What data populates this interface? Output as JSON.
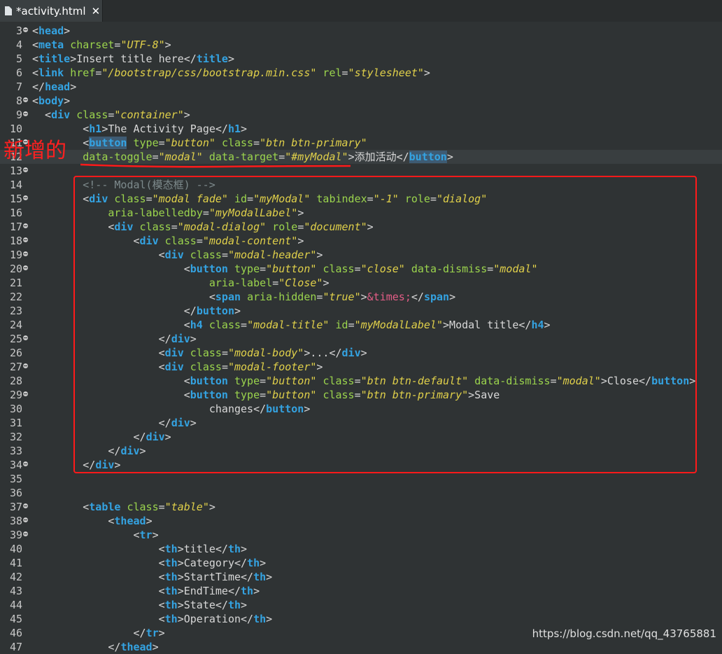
{
  "tab": {
    "title": "*activity.html",
    "close": "✕"
  },
  "annotation": {
    "text": "新增的"
  },
  "watermark": "https://blog.csdn.net/qq_43765881",
  "colors": {
    "tag": "#34a3e2",
    "attr": "#9bd44d",
    "value": "#e0d04a",
    "comment": "#7d8a8c",
    "entity": "#e35d86",
    "annotation": "#ff2020"
  },
  "lines": [
    {
      "n": "3",
      "fold": true,
      "tokens": [
        [
          "p",
          "<"
        ],
        [
          "t",
          "head"
        ],
        [
          "p",
          ">"
        ]
      ]
    },
    {
      "n": "4",
      "fold": false,
      "tokens": [
        [
          "p",
          "<"
        ],
        [
          "t",
          "meta"
        ],
        [
          "p",
          " "
        ],
        [
          "a",
          "charset"
        ],
        [
          "p",
          "="
        ],
        [
          "v",
          "\"UTF-8\""
        ],
        [
          "p",
          ">"
        ]
      ]
    },
    {
      "n": "5",
      "fold": false,
      "tokens": [
        [
          "p",
          "<"
        ],
        [
          "t",
          "title"
        ],
        [
          "p",
          ">Insert title here</"
        ],
        [
          "t",
          "title"
        ],
        [
          "p",
          ">"
        ]
      ]
    },
    {
      "n": "6",
      "fold": false,
      "tokens": [
        [
          "p",
          "<"
        ],
        [
          "t",
          "link"
        ],
        [
          "p",
          " "
        ],
        [
          "a",
          "href"
        ],
        [
          "p",
          "="
        ],
        [
          "v",
          "\"/bootstrap/css/bootstrap.min.css\""
        ],
        [
          "p",
          " "
        ],
        [
          "a",
          "rel"
        ],
        [
          "p",
          "="
        ],
        [
          "v",
          "\"stylesheet\""
        ],
        [
          "p",
          ">"
        ]
      ]
    },
    {
      "n": "7",
      "fold": false,
      "tokens": [
        [
          "p",
          "</"
        ],
        [
          "t",
          "head"
        ],
        [
          "p",
          ">"
        ]
      ]
    },
    {
      "n": "8",
      "fold": true,
      "tokens": [
        [
          "p",
          "<"
        ],
        [
          "t",
          "body"
        ],
        [
          "p",
          ">"
        ]
      ]
    },
    {
      "n": "9",
      "fold": true,
      "tokens": [
        [
          "p",
          "  <"
        ],
        [
          "t",
          "div"
        ],
        [
          "p",
          " "
        ],
        [
          "a",
          "class"
        ],
        [
          "p",
          "="
        ],
        [
          "v",
          "\"container\""
        ],
        [
          "p",
          ">"
        ]
      ]
    },
    {
      "n": "10",
      "fold": false,
      "tokens": [
        [
          "p",
          "        <"
        ],
        [
          "t",
          "h1"
        ],
        [
          "p",
          ">The Activity Page</"
        ],
        [
          "t",
          "h1"
        ],
        [
          "p",
          ">"
        ]
      ]
    },
    {
      "n": "11",
      "fold": true,
      "tokens": [
        [
          "p",
          "        <"
        ],
        [
          "ts",
          "button"
        ],
        [
          "p",
          " "
        ],
        [
          "a",
          "type"
        ],
        [
          "p",
          "="
        ],
        [
          "v",
          "\"button\""
        ],
        [
          "p",
          " "
        ],
        [
          "a",
          "class"
        ],
        [
          "p",
          "="
        ],
        [
          "v",
          "\"btn btn-primary\""
        ]
      ]
    },
    {
      "n": "12",
      "fold": false,
      "hl": true,
      "tokens": [
        [
          "p",
          "        "
        ],
        [
          "a",
          "data-toggle"
        ],
        [
          "p",
          "="
        ],
        [
          "v",
          "\"modal\""
        ],
        [
          "p",
          " "
        ],
        [
          "a",
          "data-target"
        ],
        [
          "p",
          "="
        ],
        [
          "v",
          "\"#myModal\""
        ],
        [
          "p",
          ">添加活动</"
        ],
        [
          "ts",
          "button"
        ],
        [
          "p",
          ">"
        ]
      ]
    },
    {
      "n": "13",
      "fold": true,
      "tokens": []
    },
    {
      "n": "14",
      "fold": false,
      "tokens": [
        [
          "p",
          "        "
        ],
        [
          "c",
          "<!-- Modal(模态框) -->"
        ]
      ]
    },
    {
      "n": "15",
      "fold": true,
      "tokens": [
        [
          "p",
          "        <"
        ],
        [
          "t",
          "div"
        ],
        [
          "p",
          " "
        ],
        [
          "a",
          "class"
        ],
        [
          "p",
          "="
        ],
        [
          "v",
          "\"modal fade\""
        ],
        [
          "p",
          " "
        ],
        [
          "a",
          "id"
        ],
        [
          "p",
          "="
        ],
        [
          "v",
          "\"myModal\""
        ],
        [
          "p",
          " "
        ],
        [
          "a",
          "tabindex"
        ],
        [
          "p",
          "="
        ],
        [
          "v",
          "\"-1\""
        ],
        [
          "p",
          " "
        ],
        [
          "a",
          "role"
        ],
        [
          "p",
          "="
        ],
        [
          "v",
          "\"dialog\""
        ]
      ]
    },
    {
      "n": "16",
      "fold": false,
      "tokens": [
        [
          "p",
          "            "
        ],
        [
          "a",
          "aria-labelledby"
        ],
        [
          "p",
          "="
        ],
        [
          "v",
          "\"myModalLabel\""
        ],
        [
          "p",
          ">"
        ]
      ]
    },
    {
      "n": "17",
      "fold": true,
      "tokens": [
        [
          "p",
          "            <"
        ],
        [
          "t",
          "div"
        ],
        [
          "p",
          " "
        ],
        [
          "a",
          "class"
        ],
        [
          "p",
          "="
        ],
        [
          "v",
          "\"modal-dialog\""
        ],
        [
          "p",
          " "
        ],
        [
          "a",
          "role"
        ],
        [
          "p",
          "="
        ],
        [
          "v",
          "\"document\""
        ],
        [
          "p",
          ">"
        ]
      ]
    },
    {
      "n": "18",
      "fold": true,
      "tokens": [
        [
          "p",
          "                <"
        ],
        [
          "t",
          "div"
        ],
        [
          "p",
          " "
        ],
        [
          "a",
          "class"
        ],
        [
          "p",
          "="
        ],
        [
          "v",
          "\"modal-content\""
        ],
        [
          "p",
          ">"
        ]
      ]
    },
    {
      "n": "19",
      "fold": true,
      "tokens": [
        [
          "p",
          "                    <"
        ],
        [
          "t",
          "div"
        ],
        [
          "p",
          " "
        ],
        [
          "a",
          "class"
        ],
        [
          "p",
          "="
        ],
        [
          "v",
          "\"modal-header\""
        ],
        [
          "p",
          ">"
        ]
      ]
    },
    {
      "n": "20",
      "fold": true,
      "tokens": [
        [
          "p",
          "                        <"
        ],
        [
          "t",
          "button"
        ],
        [
          "p",
          " "
        ],
        [
          "a",
          "type"
        ],
        [
          "p",
          "="
        ],
        [
          "v",
          "\"button\""
        ],
        [
          "p",
          " "
        ],
        [
          "a",
          "class"
        ],
        [
          "p",
          "="
        ],
        [
          "v",
          "\"close\""
        ],
        [
          "p",
          " "
        ],
        [
          "a",
          "data-dismiss"
        ],
        [
          "p",
          "="
        ],
        [
          "v",
          "\"modal\""
        ]
      ]
    },
    {
      "n": "21",
      "fold": false,
      "tokens": [
        [
          "p",
          "                            "
        ],
        [
          "a",
          "aria-label"
        ],
        [
          "p",
          "="
        ],
        [
          "v",
          "\"Close\""
        ],
        [
          "p",
          ">"
        ]
      ]
    },
    {
      "n": "22",
      "fold": false,
      "tokens": [
        [
          "p",
          "                            <"
        ],
        [
          "t",
          "span"
        ],
        [
          "p",
          " "
        ],
        [
          "a",
          "aria-hidden"
        ],
        [
          "p",
          "="
        ],
        [
          "v",
          "\"true\""
        ],
        [
          "p",
          ">"
        ],
        [
          "e",
          "&times;"
        ],
        [
          "p",
          "</"
        ],
        [
          "t",
          "span"
        ],
        [
          "p",
          ">"
        ]
      ]
    },
    {
      "n": "23",
      "fold": false,
      "tokens": [
        [
          "p",
          "                        </"
        ],
        [
          "t",
          "button"
        ],
        [
          "p",
          ">"
        ]
      ]
    },
    {
      "n": "24",
      "fold": false,
      "tokens": [
        [
          "p",
          "                        <"
        ],
        [
          "t",
          "h4"
        ],
        [
          "p",
          " "
        ],
        [
          "a",
          "class"
        ],
        [
          "p",
          "="
        ],
        [
          "v",
          "\"modal-title\""
        ],
        [
          "p",
          " "
        ],
        [
          "a",
          "id"
        ],
        [
          "p",
          "="
        ],
        [
          "v",
          "\"myModalLabel\""
        ],
        [
          "p",
          ">Modal title</"
        ],
        [
          "t",
          "h4"
        ],
        [
          "p",
          ">"
        ]
      ]
    },
    {
      "n": "25",
      "fold": true,
      "tokens": [
        [
          "p",
          "                    </"
        ],
        [
          "t",
          "div"
        ],
        [
          "p",
          ">"
        ]
      ]
    },
    {
      "n": "26",
      "fold": false,
      "tokens": [
        [
          "p",
          "                    <"
        ],
        [
          "t",
          "div"
        ],
        [
          "p",
          " "
        ],
        [
          "a",
          "class"
        ],
        [
          "p",
          "="
        ],
        [
          "v",
          "\"modal-body\""
        ],
        [
          "p",
          ">...</"
        ],
        [
          "t",
          "div"
        ],
        [
          "p",
          ">"
        ]
      ]
    },
    {
      "n": "27",
      "fold": true,
      "tokens": [
        [
          "p",
          "                    <"
        ],
        [
          "t",
          "div"
        ],
        [
          "p",
          " "
        ],
        [
          "a",
          "class"
        ],
        [
          "p",
          "="
        ],
        [
          "v",
          "\"modal-footer\""
        ],
        [
          "p",
          ">"
        ]
      ]
    },
    {
      "n": "28",
      "fold": false,
      "tokens": [
        [
          "p",
          "                        <"
        ],
        [
          "t",
          "button"
        ],
        [
          "p",
          " "
        ],
        [
          "a",
          "type"
        ],
        [
          "p",
          "="
        ],
        [
          "v",
          "\"button\""
        ],
        [
          "p",
          " "
        ],
        [
          "a",
          "class"
        ],
        [
          "p",
          "="
        ],
        [
          "v",
          "\"btn btn-default\""
        ],
        [
          "p",
          " "
        ],
        [
          "a",
          "data-dismiss"
        ],
        [
          "p",
          "="
        ],
        [
          "v",
          "\"modal\""
        ],
        [
          "p",
          ">Close</"
        ],
        [
          "t",
          "button"
        ],
        [
          "p",
          ">"
        ]
      ]
    },
    {
      "n": "29",
      "fold": true,
      "tokens": [
        [
          "p",
          "                        <"
        ],
        [
          "t",
          "button"
        ],
        [
          "p",
          " "
        ],
        [
          "a",
          "type"
        ],
        [
          "p",
          "="
        ],
        [
          "v",
          "\"button\""
        ],
        [
          "p",
          " "
        ],
        [
          "a",
          "class"
        ],
        [
          "p",
          "="
        ],
        [
          "v",
          "\"btn btn-primary\""
        ],
        [
          "p",
          ">Save"
        ]
      ]
    },
    {
      "n": "30",
      "fold": false,
      "tokens": [
        [
          "p",
          "                            changes</"
        ],
        [
          "t",
          "button"
        ],
        [
          "p",
          ">"
        ]
      ]
    },
    {
      "n": "31",
      "fold": false,
      "tokens": [
        [
          "p",
          "                    </"
        ],
        [
          "t",
          "div"
        ],
        [
          "p",
          ">"
        ]
      ]
    },
    {
      "n": "32",
      "fold": false,
      "tokens": [
        [
          "p",
          "                </"
        ],
        [
          "t",
          "div"
        ],
        [
          "p",
          ">"
        ]
      ]
    },
    {
      "n": "33",
      "fold": false,
      "tokens": [
        [
          "p",
          "            </"
        ],
        [
          "t",
          "div"
        ],
        [
          "p",
          ">"
        ]
      ]
    },
    {
      "n": "34",
      "fold": true,
      "tokens": [
        [
          "p",
          "        </"
        ],
        [
          "t",
          "div"
        ],
        [
          "p",
          ">"
        ]
      ]
    },
    {
      "n": "35",
      "fold": false,
      "tokens": []
    },
    {
      "n": "36",
      "fold": false,
      "tokens": []
    },
    {
      "n": "37",
      "fold": true,
      "tokens": [
        [
          "p",
          "        <"
        ],
        [
          "t",
          "table"
        ],
        [
          "p",
          " "
        ],
        [
          "a",
          "class"
        ],
        [
          "p",
          "="
        ],
        [
          "v",
          "\"table\""
        ],
        [
          "p",
          ">"
        ]
      ]
    },
    {
      "n": "38",
      "fold": true,
      "tokens": [
        [
          "p",
          "            <"
        ],
        [
          "t",
          "thead"
        ],
        [
          "p",
          ">"
        ]
      ]
    },
    {
      "n": "39",
      "fold": true,
      "tokens": [
        [
          "p",
          "                <"
        ],
        [
          "t",
          "tr"
        ],
        [
          "p",
          ">"
        ]
      ]
    },
    {
      "n": "40",
      "fold": false,
      "tokens": [
        [
          "p",
          "                    <"
        ],
        [
          "t",
          "th"
        ],
        [
          "p",
          ">title</"
        ],
        [
          "t",
          "th"
        ],
        [
          "p",
          ">"
        ]
      ]
    },
    {
      "n": "41",
      "fold": false,
      "tokens": [
        [
          "p",
          "                    <"
        ],
        [
          "t",
          "th"
        ],
        [
          "p",
          ">Category</"
        ],
        [
          "t",
          "th"
        ],
        [
          "p",
          ">"
        ]
      ]
    },
    {
      "n": "42",
      "fold": false,
      "tokens": [
        [
          "p",
          "                    <"
        ],
        [
          "t",
          "th"
        ],
        [
          "p",
          ">StartTime</"
        ],
        [
          "t",
          "th"
        ],
        [
          "p",
          ">"
        ]
      ]
    },
    {
      "n": "43",
      "fold": false,
      "tokens": [
        [
          "p",
          "                    <"
        ],
        [
          "t",
          "th"
        ],
        [
          "p",
          ">EndTime</"
        ],
        [
          "t",
          "th"
        ],
        [
          "p",
          ">"
        ]
      ]
    },
    {
      "n": "44",
      "fold": false,
      "tokens": [
        [
          "p",
          "                    <"
        ],
        [
          "t",
          "th"
        ],
        [
          "p",
          ">State</"
        ],
        [
          "t",
          "th"
        ],
        [
          "p",
          ">"
        ]
      ]
    },
    {
      "n": "45",
      "fold": false,
      "tokens": [
        [
          "p",
          "                    <"
        ],
        [
          "t",
          "th"
        ],
        [
          "p",
          ">Operation</"
        ],
        [
          "t",
          "th"
        ],
        [
          "p",
          ">"
        ]
      ]
    },
    {
      "n": "46",
      "fold": false,
      "tokens": [
        [
          "p",
          "                </"
        ],
        [
          "t",
          "tr"
        ],
        [
          "p",
          ">"
        ]
      ]
    },
    {
      "n": "47",
      "fold": false,
      "tokens": [
        [
          "p",
          "            </"
        ],
        [
          "t",
          "thead"
        ],
        [
          "p",
          ">"
        ]
      ]
    }
  ]
}
